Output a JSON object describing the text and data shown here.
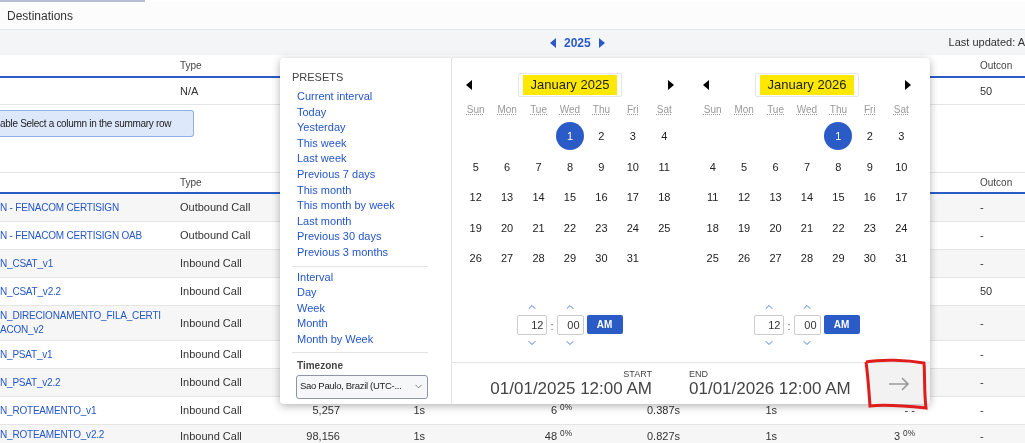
{
  "page_tab": "Destinations",
  "toolbar": {
    "year": "2025",
    "last_updated": "Last updated: A"
  },
  "summary_table": {
    "columns": [
      "Type",
      "Outcon"
    ],
    "row": {
      "type": "N/A",
      "outcome": "50"
    }
  },
  "hint": "able Select a column in the summary row",
  "detail_table": {
    "columns": [
      "Type",
      "Outcon"
    ],
    "rows": [
      {
        "name": [
          "N - FENACOM CERTISIGN"
        ],
        "type": "Outbound Call",
        "outcome": "-"
      },
      {
        "name": [
          "N - FENACOM CERTISIGN OAB"
        ],
        "type": "Outbound Call",
        "outcome": "-"
      },
      {
        "name": [
          "N_CSAT_v1"
        ],
        "type": "Inbound Call",
        "outcome": "-"
      },
      {
        "name": [
          "N_CSAT_v2.2"
        ],
        "type": "Inbound Call",
        "outcome": "50"
      },
      {
        "name": [
          "N_DIRECIONAMENTO_FILA_CERTI",
          "ACON_v2"
        ],
        "type": "Inbound Call",
        "outcome": "-"
      },
      {
        "name": [
          "N_PSAT_v1"
        ],
        "type": "Inbound Call",
        "outcome": "-"
      },
      {
        "name": [
          "N_PSAT_v2.2"
        ],
        "type": "Inbound Call",
        "outcome": "-"
      },
      {
        "name": [
          "N_ROTEAMENTO_v1"
        ],
        "type": "Inbound Call",
        "metrics": [
          "5,257",
          "1s",
          "6 $^{0%}$",
          "0.387s",
          "1s",
          "- -"
        ],
        "outcome": "-"
      },
      {
        "name": [
          "N_ROTEAMENTO_v2.2"
        ],
        "type": "Inbound Call",
        "metrics": [
          "98,156",
          "1s",
          "48 $^{0%}$",
          "0.827s",
          "1s",
          "3 $^{0%}$"
        ],
        "outcome": "-"
      }
    ]
  },
  "date_picker": {
    "presets": {
      "title": "PRESETS",
      "groups": [
        [
          "Current interval",
          "Today",
          "Yesterday",
          "This week",
          "Last week",
          "Previous 7 days",
          "This month",
          "This month by week",
          "Last month",
          "Previous 30 days",
          "Previous 3 months"
        ],
        [
          "Interval",
          "Day",
          "Week",
          "Month",
          "Month by Week"
        ]
      ]
    },
    "timezone": {
      "label": "Timezone",
      "value": "Sao Paulo, Brazil (UTC-..."
    },
    "months": [
      {
        "title": "January 2025",
        "weekdays": [
          "Sun",
          "Mon",
          "Tue",
          "Wed",
          "Thu",
          "Fri",
          "Sat"
        ],
        "weeks": [
          [
            {
              "d": "1",
              "selected": true
            },
            {
              "d": "2",
              "selected": false
            },
            {
              "d": "3",
              "selected": false
            },
            {
              "d": "4",
              "selected": false
            }
          ],
          [
            {
              "d": "5",
              "selected": false
            },
            {
              "d": "6",
              "selected": false
            },
            {
              "d": "7",
              "selected": false
            },
            {
              "d": "8",
              "selected": false
            },
            {
              "d": "9",
              "selected": false
            },
            {
              "d": "10",
              "selected": false
            },
            {
              "d": "11",
              "selected": false
            }
          ],
          [
            {
              "d": "12",
              "selected": false
            },
            {
              "d": "13",
              "selected": false
            },
            {
              "d": "14",
              "selected": false
            },
            {
              "d": "15",
              "selected": false
            },
            {
              "d": "16",
              "selected": false
            },
            {
              "d": "17",
              "selected": false
            },
            {
              "d": "18",
              "selected": false
            }
          ],
          [
            {
              "d": "19",
              "selected": false
            },
            {
              "d": "20",
              "selected": false
            },
            {
              "d": "21",
              "selected": false
            },
            {
              "d": "22",
              "selected": false
            },
            {
              "d": "23",
              "selected": false
            },
            {
              "d": "24",
              "selected": false
            },
            {
              "d": "25",
              "selected": false
            }
          ],
          [
            {
              "d": "26",
              "selected": false
            },
            {
              "d": "27",
              "selected": false
            },
            {
              "d": "28",
              "selected": false
            },
            {
              "d": "29",
              "selected": false
            },
            {
              "d": "30",
              "selected": false
            },
            {
              "d": "31",
              "selected": false
            }
          ]
        ],
        "time": {
          "hour": "12",
          "separator": ":",
          "minute": "00",
          "period": "AM"
        }
      },
      {
        "title": "January 2026",
        "weekdays": [
          "Sun",
          "Mon",
          "Tue",
          "Wed",
          "Thu",
          "Fri",
          "Sat"
        ],
        "weeks": [
          [
            {
              "d": "1",
              "selected": true
            },
            {
              "d": "2",
              "selected": false
            },
            {
              "d": "3",
              "selected": false
            }
          ],
          [
            {
              "d": "4",
              "selected": false
            },
            {
              "d": "5",
              "selected": false
            },
            {
              "d": "6",
              "selected": false
            },
            {
              "d": "7",
              "selected": false
            },
            {
              "d": "8",
              "selected": false
            },
            {
              "d": "9",
              "selected": false
            },
            {
              "d": "10",
              "selected": false
            }
          ],
          [
            {
              "d": "11",
              "selected": false
            },
            {
              "d": "12",
              "selected": false
            },
            {
              "d": "13",
              "selected": false
            },
            {
              "d": "14",
              "selected": false
            },
            {
              "d": "15",
              "selected": false
            },
            {
              "d": "16",
              "selected": false
            },
            {
              "d": "17",
              "selected": false
            }
          ],
          [
            {
              "d": "18",
              "selected": false
            },
            {
              "d": "19",
              "selected": false
            },
            {
              "d": "20",
              "selected": false
            },
            {
              "d": "21",
              "selected": false
            },
            {
              "d": "22",
              "selected": false
            },
            {
              "d": "23",
              "selected": false
            },
            {
              "d": "24",
              "selected": false
            }
          ],
          [
            {
              "d": "25",
              "selected": false
            },
            {
              "d": "26",
              "selected": false
            },
            {
              "d": "27",
              "selected": false
            },
            {
              "d": "28",
              "selected": false
            },
            {
              "d": "29",
              "selected": false
            },
            {
              "d": "30",
              "selected": false
            },
            {
              "d": "31",
              "selected": false
            }
          ]
        ],
        "time": {
          "hour": "12",
          "separator": ":",
          "minute": "00",
          "period": "AM"
        }
      }
    ],
    "range": {
      "start_label": "START",
      "start": "01/01/2025 12:00 AM",
      "end_label": "END",
      "end": "01/01/2026 12:00 AM"
    }
  }
}
